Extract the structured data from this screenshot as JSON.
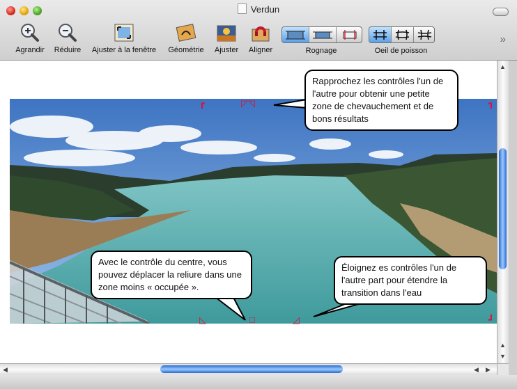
{
  "window": {
    "title": "Verdun"
  },
  "toolbar": {
    "zoom_in": "Agrandir",
    "zoom_out": "Réduire",
    "fit": "Ajuster à la fenêtre",
    "geometry": "Géométrie",
    "adjust": "Ajuster",
    "align": "Aligner",
    "crop_label": "Rognage",
    "fisheye_label": "Oeil de poisson",
    "overflow": "»"
  },
  "callouts": {
    "top": "Rapprochez les contrôles l'un de l'autre pour obtenir une petite zone de chevauchement et de bons résultats",
    "left": "Avec le contrôle du centre, vous pouvez déplacer la reliure dans une zone moins « occupée ».",
    "right": "Éloignez es contrôles l'un de l'autre part pour étendre la transition dans l'eau"
  },
  "colors": {
    "accent": "#2a6bd0",
    "marker": "#e0103a"
  }
}
